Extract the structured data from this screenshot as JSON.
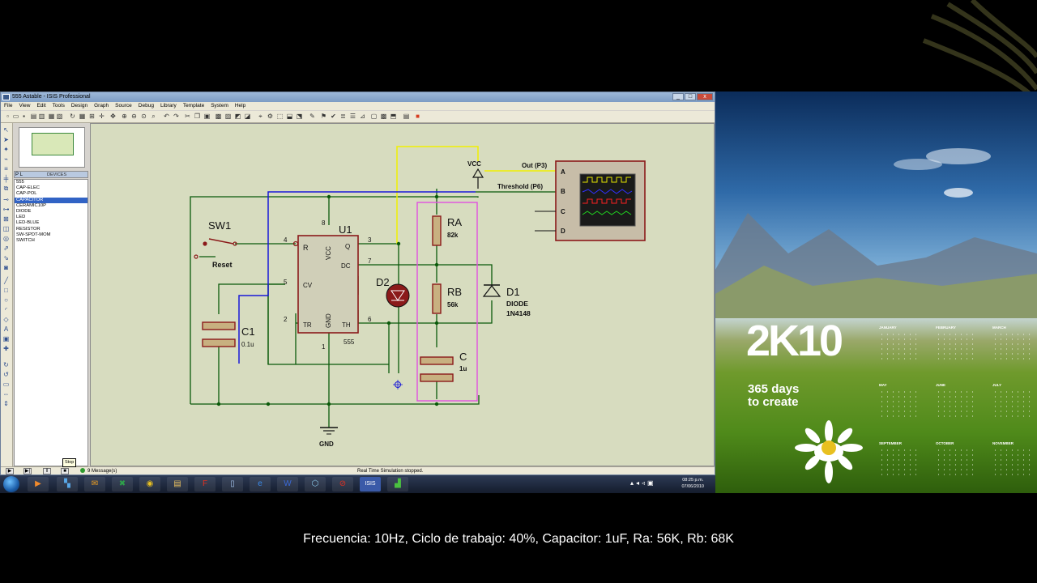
{
  "window": {
    "title": "555 Astable - ISIS Professional",
    "app_icon": "isis-icon",
    "controls": [
      "_",
      "□",
      "x"
    ]
  },
  "menu": [
    "File",
    "View",
    "Edit",
    "Tools",
    "Design",
    "Graph",
    "Source",
    "Debug",
    "Library",
    "Template",
    "System",
    "Help"
  ],
  "device_panel": {
    "tab_p": "P",
    "tab_l": "L",
    "header": "DEVICES",
    "items": [
      "555",
      "CAP-ELEC",
      "CAP-POL",
      "CAPACITOR",
      "CERAMIC10P",
      "DIODE",
      "LED",
      "LED-BLUE",
      "RESISTOR",
      "SW-SPDT-MOM",
      "SWITCH"
    ],
    "selected_index": 3
  },
  "schematic": {
    "u1": {
      "ref": "U1",
      "part": "555",
      "pins": {
        "r": "R",
        "vcc": "VCC",
        "q": "Q",
        "dc": "DC",
        "cv": "CV",
        "tr": "TR",
        "gnd": "GND",
        "th": "TH"
      },
      "pin_numbers": {
        "p4": "4",
        "p8": "8",
        "p3": "3",
        "p7": "7",
        "p5": "5",
        "p2": "2",
        "p1": "1",
        "p6": "6"
      }
    },
    "sw1": {
      "ref": "SW1",
      "label": "Reset"
    },
    "c1": {
      "ref": "C1",
      "value": "0.1u"
    },
    "d2": {
      "ref": "D2"
    },
    "ra": {
      "ref": "RA",
      "value": "82k"
    },
    "rb": {
      "ref": "RB",
      "value": "56k"
    },
    "c": {
      "ref": "C",
      "value": "1u"
    },
    "d1": {
      "ref": "D1",
      "type": "DIODE",
      "part": "1N4148"
    },
    "vcc": "VCC",
    "gnd": "GND",
    "probe_out": "Out (P3)",
    "probe_threshold": "Threshold (P6)",
    "scope_channels": [
      "A",
      "B",
      "C",
      "D"
    ],
    "colors": {
      "wire": "#006400",
      "yellow_wire": "#f5f500",
      "blue_wire": "#1515d8",
      "component": "#8b1a1a",
      "bbox": "#e050e0"
    }
  },
  "status": {
    "tooltip": "Stop",
    "messages": "9 Message(s)",
    "simulation": "Real Time Simulation stopped."
  },
  "taskbar": {
    "time": "08:25 p.m.",
    "date": "07/06/2010",
    "apps": [
      "media-icon",
      "flip-icon",
      "outlook-icon",
      "excel-icon",
      "chrome-icon",
      "explorer-icon",
      "pdf-icon",
      "notes-icon",
      "ie-icon",
      "word-icon",
      "box-icon",
      "block-icon",
      "isis-icon",
      "ares-icon"
    ]
  },
  "wallpaper": {
    "title": "2K10",
    "subtitle1": "365 days",
    "subtitle2": "to create",
    "months": [
      "JANUARY",
      "FEBRUARY",
      "MARCH",
      "MAY",
      "JUNE",
      "JULY",
      "SEPTEMBER",
      "OCTOBER",
      "NOVEMBER"
    ]
  },
  "caption": "Frecuencia: 10Hz, Ciclo de trabajo: 40%, Capacitor: 1uF, Ra: 56K, Rb: 68K"
}
